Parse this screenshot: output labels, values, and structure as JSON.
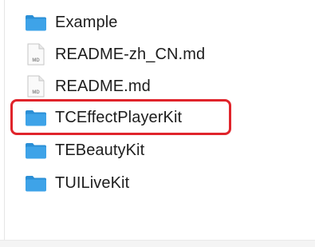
{
  "colors": {
    "folder": "#3ea3e8",
    "folder_tab": "#2b8fd6",
    "highlight": "#e0242b",
    "text": "#1d1d1d"
  },
  "items": [
    {
      "label": "Example",
      "kind": "folder",
      "icon": "folder-icon"
    },
    {
      "label": "README-zh_CN.md",
      "kind": "markdown",
      "icon": "markdown-file-icon",
      "badge": "MD"
    },
    {
      "label": "README.md",
      "kind": "markdown",
      "icon": "markdown-file-icon",
      "badge": "MD"
    },
    {
      "label": "TCEffectPlayerKit",
      "kind": "folder",
      "icon": "folder-icon",
      "highlighted": true
    },
    {
      "label": "TEBeautyKit",
      "kind": "folder",
      "icon": "folder-icon"
    },
    {
      "label": "TUILiveKit",
      "kind": "folder",
      "icon": "folder-icon"
    }
  ]
}
